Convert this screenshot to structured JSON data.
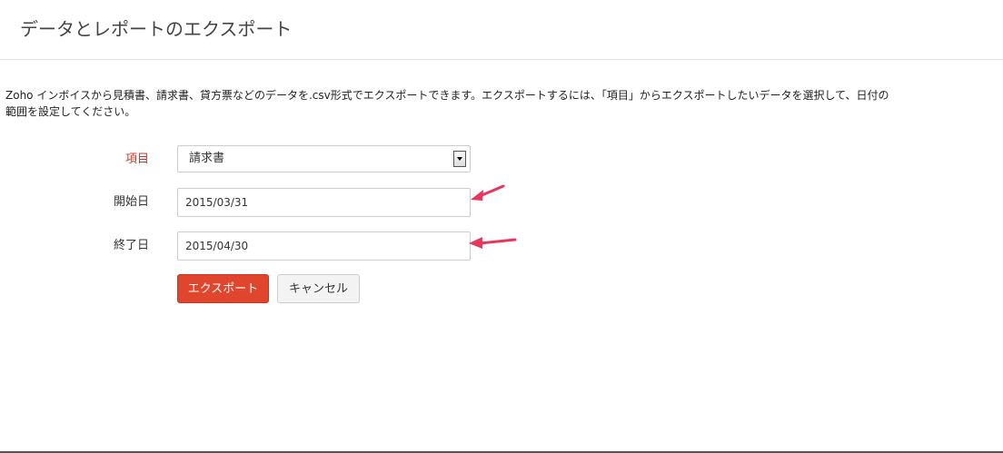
{
  "header": {
    "title": "データとレポートのエクスポート"
  },
  "description": {
    "line1": "Zoho インボイスから見積書、請求書、貸方票などのデータを.csv形式でエクスポートできます。エクスポートするには、「項目」からエクスポートしたいデータを選択して、日付の",
    "line2": "範囲を設定してください。"
  },
  "form": {
    "item": {
      "label": "項目",
      "value": "請求書"
    },
    "start_date": {
      "label": "開始日",
      "value": "2015/03/31"
    },
    "end_date": {
      "label": "終了日",
      "value": "2015/04/30"
    }
  },
  "buttons": {
    "export_label": "エクスポート",
    "cancel_label": "キャンセル"
  },
  "colors": {
    "primary_button": "#e0452e",
    "required_label": "#c0392b",
    "annotation_arrow": "#e8365d"
  },
  "icons": {
    "select_arrow": "chevron-down-icon",
    "annotation": "arrow-left-icon"
  }
}
